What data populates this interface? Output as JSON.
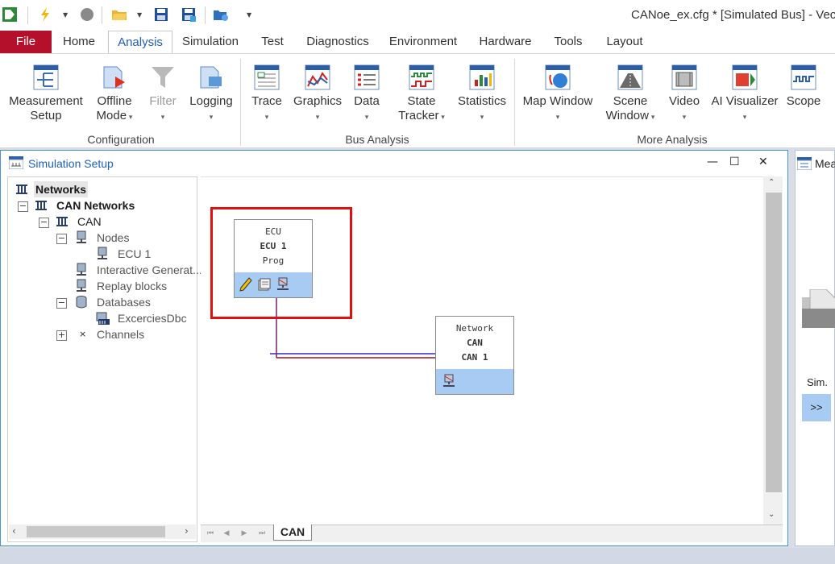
{
  "window": {
    "title": "CANoe_ex.cfg * [Simulated Bus] - Vec"
  },
  "tabs": [
    {
      "label": "File"
    },
    {
      "label": "Home"
    },
    {
      "label": "Analysis"
    },
    {
      "label": "Simulation"
    },
    {
      "label": "Test"
    },
    {
      "label": "Diagnostics"
    },
    {
      "label": "Environment"
    },
    {
      "label": "Hardware"
    },
    {
      "label": "Tools"
    },
    {
      "label": "Layout"
    }
  ],
  "ribbon": {
    "buttons": [
      {
        "label": "Measurement",
        "label2": "Setup"
      },
      {
        "label": "Offline",
        "label2": "Mode"
      },
      {
        "label": "Filter"
      },
      {
        "label": "Logging"
      },
      {
        "label": "Trace"
      },
      {
        "label": "Graphics"
      },
      {
        "label": "Data"
      },
      {
        "label": "State",
        "label2": "Tracker"
      },
      {
        "label": "Statistics"
      },
      {
        "label": "Map Window"
      },
      {
        "label": "Scene",
        "label2": "Window"
      },
      {
        "label": "Video"
      },
      {
        "label": "AI Visualizer"
      },
      {
        "label": "Scope"
      }
    ],
    "groups": [
      {
        "label": "Configuration"
      },
      {
        "label": "Bus Analysis"
      },
      {
        "label": "More Analysis"
      }
    ]
  },
  "sim": {
    "title": "Simulation Setup",
    "tree": [
      {
        "label": "Networks"
      },
      {
        "label": "CAN Networks"
      },
      {
        "label": "CAN"
      },
      {
        "label": "Nodes"
      },
      {
        "label": "ECU 1"
      },
      {
        "label": "Interactive Generat..."
      },
      {
        "label": "Replay blocks"
      },
      {
        "label": "Databases"
      },
      {
        "label": "ExcerciesDbc"
      },
      {
        "label": "Channels"
      }
    ],
    "ecu_block": {
      "type": "ECU",
      "name": "ECU 1",
      "mode": "Prog"
    },
    "network_block": {
      "type": "Network",
      "bus": "CAN",
      "name": "CAN 1"
    },
    "sheet_tab": "CAN"
  },
  "right_panel": {
    "title": "Mea",
    "sim_label": "Sim.",
    "button": ">>"
  },
  "colors": {
    "accent": "#1e5fb8",
    "file_tab": "#b5102b",
    "highlight": "#e01010",
    "block_footer": "#a8cbf4"
  }
}
